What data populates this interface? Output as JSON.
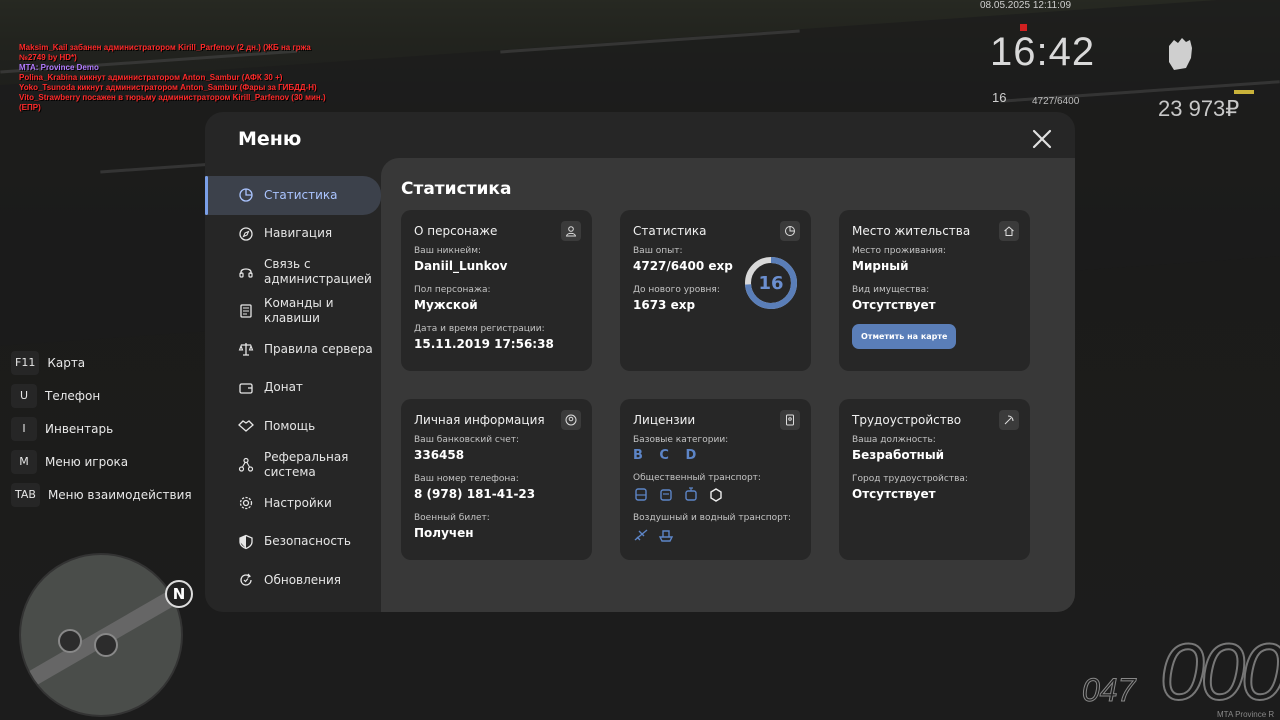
{
  "hud": {
    "datetime": "08.05.2025 12:11:09",
    "clock": "16:42",
    "level": "16",
    "exp": "4727/6400",
    "money": "23 973₽",
    "speed": "000",
    "fuel": "047",
    "watermark": "MTA Province R"
  },
  "chat": [
    {
      "text": "Maksim_Kail забанен администратором Kirill_Parfenov (2 дн.) (ЖБ на гржа",
      "color": "#ff2a2a"
    },
    {
      "text": " №2749 by HD*)",
      "color": "#ff2a2a"
    },
    {
      "text": "MTA: Province Demo",
      "color": "#b37cff"
    },
    {
      "text": "Polina_Krabina кикнут администратором Anton_Sambur (АФК 30 +)",
      "color": "#ff2a2a"
    },
    {
      "text": "Yoko_Tsunoda кикнут администратором Anton_Sambur (Фары за ГИБДД-Н)",
      "color": "#ff2a2a"
    },
    {
      "text": "Vito_Strawberry посажен в тюрьму администратором Kirill_Parfenov (30 мин.)",
      "color": "#ff2a2a"
    },
    {
      "text": "(ЕПР)",
      "color": "#ff2a2a"
    }
  ],
  "hotkeys": [
    {
      "key": "F11",
      "label": "Карта"
    },
    {
      "key": "U",
      "label": "Телефон"
    },
    {
      "key": "I",
      "label": "Инвентарь"
    },
    {
      "key": "M",
      "label": "Меню игрока"
    },
    {
      "key": "TAB",
      "label": "Меню взаимодействия"
    }
  ],
  "menu": {
    "title": "Меню",
    "nav": [
      {
        "label": "Статистика",
        "icon": "pie-chart-icon",
        "active": true
      },
      {
        "label": "Навигация",
        "icon": "compass-icon"
      },
      {
        "label": "Связь с администрацией",
        "icon": "headset-icon"
      },
      {
        "label": "Команды и клавиши",
        "icon": "document-icon"
      },
      {
        "label": "Правила сервера",
        "icon": "scales-icon"
      },
      {
        "label": "Донат",
        "icon": "wallet-icon"
      },
      {
        "label": "Помощь",
        "icon": "handshake-icon"
      },
      {
        "label": "Реферальная система",
        "icon": "network-icon"
      },
      {
        "label": "Настройки",
        "icon": "gear-icon"
      },
      {
        "label": "Безопасность",
        "icon": "shield-icon"
      },
      {
        "label": "Обновления",
        "icon": "refresh-icon"
      }
    ]
  },
  "stats": {
    "title": "Статистика",
    "character": {
      "title": "О персонаже",
      "nick_label": "Ваш никнейм:",
      "nick": "Daniil_Lunkov",
      "gender_label": "Пол персонажа:",
      "gender": "Мужской",
      "reg_label": "Дата и время регистрации:",
      "reg": "15.11.2019 17:56:38"
    },
    "statistics": {
      "title": "Статистика",
      "exp_label": "Ваш опыт:",
      "exp": "4727/6400 exp",
      "next_label": "До нового уровня:",
      "next": "1673 exp",
      "level": "16",
      "progress": 0.7386
    },
    "residence": {
      "title": "Место жительства",
      "place_label": "Место проживания:",
      "place": "Мирный",
      "property_label": "Вид имущества:",
      "property": "Отсутствует",
      "button": "Отметить на карте"
    },
    "personal": {
      "title": "Личная информация",
      "bank_label": "Ваш банковский счет:",
      "bank": "336458",
      "phone_label": "Ваш номер телефона:",
      "phone": "8 (978) 181-41-23",
      "military_label": "Военный билет:",
      "military": "Получен"
    },
    "licenses": {
      "title": "Лицензии",
      "base_label": "Базовые категории:",
      "base": "B C D",
      "public_label": "Общественный транспорт:",
      "air_label": "Воздушный и водный транспорт:"
    },
    "employment": {
      "title": "Трудоустройство",
      "position_label": "Ваша должность:",
      "position": "Безработный",
      "city_label": "Город трудоустройства:",
      "city": "Отсутствует"
    }
  }
}
